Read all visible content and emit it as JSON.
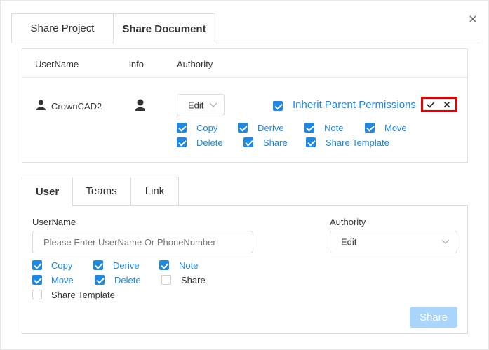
{
  "tabs": [
    "Share Project",
    "Share Document"
  ],
  "table": {
    "headers": [
      "UserName",
      "info",
      "Authority"
    ],
    "row": {
      "username": "CrownCAD2",
      "authority": "Edit",
      "inherit_label": "Inherit Parent Permissions",
      "permissions": [
        {
          "label": "Copy",
          "checked": true
        },
        {
          "label": "Derive",
          "checked": true
        },
        {
          "label": "Note",
          "checked": true
        },
        {
          "label": "Move",
          "checked": true
        },
        {
          "label": "Delete",
          "checked": true
        },
        {
          "label": "Share",
          "checked": true
        },
        {
          "label": "Share Template",
          "checked": true
        }
      ]
    }
  },
  "subtabs": [
    "User",
    "Teams",
    "Link"
  ],
  "form": {
    "username_label": "UserName",
    "username_placeholder": "Please Enter UserName Or PhoneNumber",
    "authority_label": "Authority",
    "authority_value": "Edit",
    "permissions": [
      {
        "label": "Copy",
        "checked": true
      },
      {
        "label": "Derive",
        "checked": true
      },
      {
        "label": "Note",
        "checked": true
      },
      {
        "label": "Move",
        "checked": true
      },
      {
        "label": "Delete",
        "checked": true
      },
      {
        "label": "Share",
        "checked": false
      },
      {
        "label": "Share Template",
        "checked": false
      }
    ],
    "share_label": "Share"
  },
  "colors": {
    "accent": "#1e88e5",
    "highlight": "#e50000",
    "disabled_button": "#a9d4fb"
  }
}
